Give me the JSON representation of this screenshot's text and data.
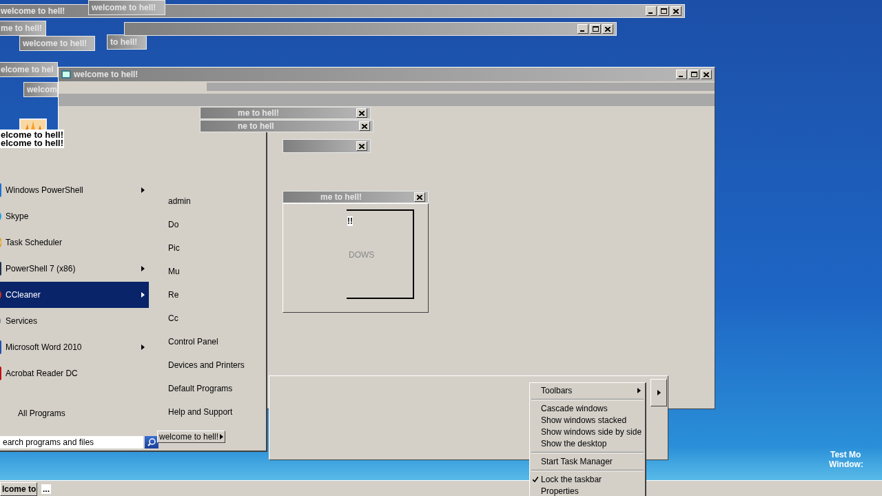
{
  "background_windows": [
    {
      "title": "welcome to hell!"
    },
    {
      "title": "welcome to hell!"
    },
    {
      "title": "me to hell!"
    },
    {
      "title": "welcome to hell!"
    },
    {
      "title": "to hell!"
    },
    {
      "title": "elcome to hel"
    },
    {
      "title": "welcom"
    }
  ],
  "main_window": {
    "title": "welcome to hell!"
  },
  "small_windows": [
    {
      "title": "me to hell!"
    },
    {
      "title": "ne to hell"
    },
    {
      "title": "me to hell!"
    }
  ],
  "dialog": {
    "text_1": "!!",
    "text_2": "DOWS"
  },
  "banner_texts": [
    "elcome to hell!",
    "elcome to hell!"
  ],
  "start_menu": {
    "programs": [
      {
        "label": "Windows PowerShell",
        "submenu": true,
        "selected": false
      },
      {
        "label": "Skype",
        "submenu": false,
        "selected": false
      },
      {
        "label": "Task Scheduler",
        "submenu": false,
        "selected": false
      },
      {
        "label": "PowerShell 7 (x86)",
        "submenu": true,
        "selected": false
      },
      {
        "label": "CCleaner",
        "submenu": true,
        "selected": true
      },
      {
        "label": "Services",
        "submenu": false,
        "selected": false
      },
      {
        "label": "Microsoft Word 2010",
        "submenu": true,
        "selected": false
      },
      {
        "label": "Acrobat Reader DC",
        "submenu": false,
        "selected": false
      }
    ],
    "all_programs": "All Programs",
    "search": {
      "value": "earch programs and files"
    },
    "places": [
      "admin",
      "Do",
      "Pic",
      "Mu",
      "Re",
      "Cc",
      "Control Panel",
      "Devices and Printers",
      "Default Programs",
      "Help and Support"
    ],
    "shutdown": "welcome to hell!"
  },
  "context_menu": [
    {
      "kind": "item",
      "label": "Toolbars",
      "submenu": true,
      "checked": false
    },
    {
      "kind": "separator"
    },
    {
      "kind": "item",
      "label": "Cascade windows",
      "submenu": false,
      "checked": false
    },
    {
      "kind": "item",
      "label": "Show windows stacked",
      "submenu": false,
      "checked": false
    },
    {
      "kind": "item",
      "label": "Show windows side by side",
      "submenu": false,
      "checked": false
    },
    {
      "kind": "item",
      "label": "Show the desktop",
      "submenu": false,
      "checked": false
    },
    {
      "kind": "separator"
    },
    {
      "kind": "item",
      "label": "Start Task Manager",
      "submenu": false,
      "checked": false
    },
    {
      "kind": "separator"
    },
    {
      "kind": "item",
      "label": "Lock the taskbar",
      "submenu": false,
      "checked": true
    },
    {
      "kind": "item",
      "label": "Properties",
      "submenu": false,
      "checked": false
    }
  ],
  "desktop_text": [
    "Test Mo",
    "Window:"
  ],
  "taskbar": {
    "button": "lcome to",
    "overflow": "..."
  }
}
